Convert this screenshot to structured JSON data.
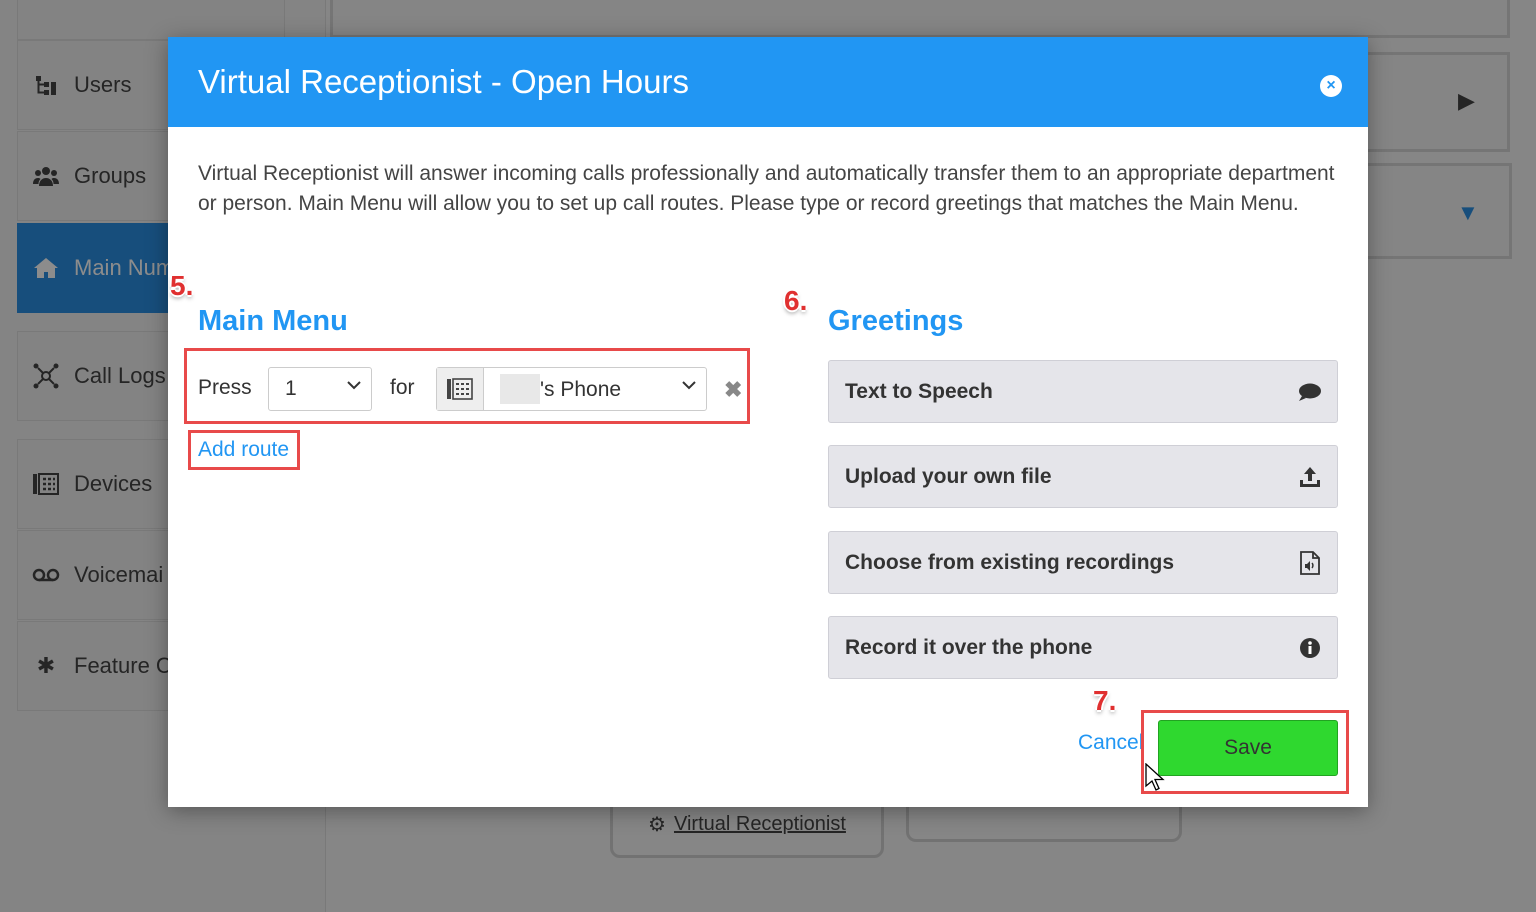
{
  "sidebar": {
    "items": [
      {
        "label": "Users",
        "icon": "users-tree-icon"
      },
      {
        "label": "Groups",
        "icon": "groups-icon"
      },
      {
        "label": "Main Num",
        "icon": "home-icon",
        "active": true
      },
      {
        "label": "Call Logs",
        "icon": "network-icon"
      },
      {
        "label": "Devices",
        "icon": "devices-icon"
      },
      {
        "label": "Voicemai",
        "icon": "voicemail-icon"
      },
      {
        "label": "Feature Co",
        "icon": "asterisk-icon"
      }
    ]
  },
  "background": {
    "virtual_receptionist_link": "Virtual Receptionist"
  },
  "modal": {
    "title": "Virtual Receptionist - Open Hours",
    "intro": "Virtual Receptionist will answer incoming calls professionally and automatically transfer them to an appropriate department or person. Main Menu will allow you to set up call routes. Please type or record greetings that matches the Main Menu.",
    "main_menu": {
      "title": "Main Menu",
      "press_label": "Press",
      "key_value": "1",
      "for_label": "for",
      "destination_value": "'s Phone",
      "add_route_label": "Add route"
    },
    "greetings": {
      "title": "Greetings",
      "options": [
        {
          "label": "Text to Speech",
          "icon": "speech-bubble-icon"
        },
        {
          "label": "Upload your own file",
          "icon": "upload-icon"
        },
        {
          "label": "Choose from existing recordings",
          "icon": "audio-file-icon"
        },
        {
          "label": "Record it over the phone",
          "icon": "info-icon"
        }
      ]
    },
    "cancel_label": "Cancel",
    "save_label": "Save"
  },
  "annotations": {
    "step5": "5.",
    "step6": "6.",
    "step7": "7."
  },
  "colors": {
    "header": "#2196f3",
    "save": "#2fd82f",
    "highlight": "#e84a4a",
    "sidebar_active": "#2b8fe2"
  }
}
